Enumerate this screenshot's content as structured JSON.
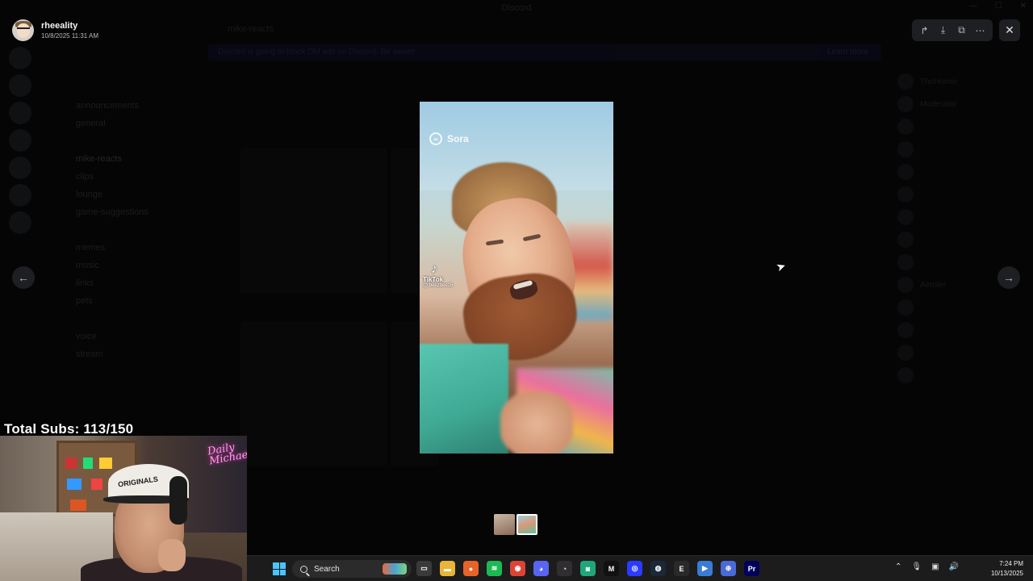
{
  "app": {
    "window_title": "Discord",
    "channel": "mike-reacts",
    "banner_text": "Discord is going to block DM ads on Discord. Be aware.",
    "banner_link": "Learn more"
  },
  "background": {
    "channels": [
      "announcements",
      "general",
      "",
      "mike-reacts",
      "clips",
      "lounge",
      "game-suggestions",
      "",
      "memes",
      "music",
      "links",
      "pets",
      "",
      "voice",
      "stream"
    ],
    "active_channel_index": 3,
    "members": [
      "TheHomie",
      "Moderator",
      "",
      "",
      "",
      "",
      "",
      "",
      "",
      "Aeroler",
      "",
      "",
      "",
      ""
    ]
  },
  "viewer": {
    "author_name": "rheeality",
    "author_timestamp": "10/8/2025 11:31 AM",
    "tools": [
      {
        "name": "forward-icon",
        "glyph": "↱"
      },
      {
        "name": "download-icon",
        "glyph": "⤓"
      },
      {
        "name": "open-external-icon",
        "glyph": "⧉"
      },
      {
        "name": "more-icon",
        "glyph": "⋯"
      }
    ],
    "close_glyph": "✕",
    "prev_glyph": "←",
    "next_glyph": "→",
    "media_watermark": "Sora",
    "tiktok_label": "TikTok",
    "tiktok_handle": "@ beezbeez6",
    "thumbnail_count": 2,
    "selected_thumbnail": 2
  },
  "overlay": {
    "subs_text": "Total Subs: 113/150",
    "cap_text": "ORIGINALS",
    "neon_text": "Daily\nMichael"
  },
  "taskbar": {
    "search_label": "Search",
    "apps": [
      {
        "name": "file-explorer-icon",
        "color": "#3a3a3a",
        "glyph": "▭"
      },
      {
        "name": "folder-icon",
        "color": "#e8b53a",
        "glyph": "▬"
      },
      {
        "name": "firefox-icon",
        "color": "#e8632a",
        "glyph": "●"
      },
      {
        "name": "spotify-icon",
        "color": "#1db954",
        "glyph": "≋"
      },
      {
        "name": "chrome-icon",
        "color": "#db4437",
        "glyph": "◉"
      },
      {
        "name": "discord-icon",
        "color": "#5865f2",
        "glyph": "◕"
      },
      {
        "name": "obs-icon",
        "color": "#302e31",
        "glyph": "◔"
      },
      {
        "name": "app-green-icon",
        "color": "#1fa67a",
        "glyph": "◙"
      },
      {
        "name": "app-m-icon",
        "color": "#111111",
        "glyph": "M"
      },
      {
        "name": "app-globe-icon",
        "color": "#2a3cff",
        "glyph": "◎"
      },
      {
        "name": "steam-icon",
        "color": "#1b2838",
        "glyph": "◍"
      },
      {
        "name": "epic-icon",
        "color": "#2a2a2a",
        "glyph": "E"
      },
      {
        "name": "app-play-icon",
        "color": "#3a7bd5",
        "glyph": "▶"
      },
      {
        "name": "app-net-icon",
        "color": "#4a6ad8",
        "glyph": "⊕"
      },
      {
        "name": "premiere-icon",
        "color": "#00005b",
        "glyph": "Pr"
      }
    ],
    "time": "7:24 PM",
    "date": "10/13/2025"
  }
}
